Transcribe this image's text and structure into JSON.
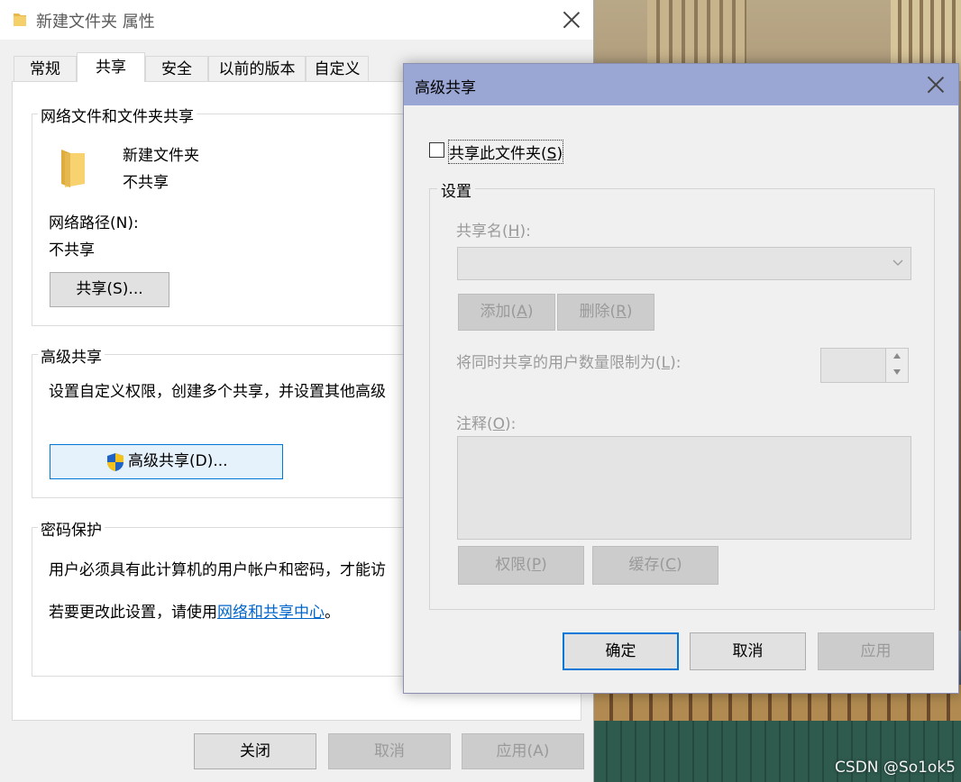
{
  "properties_window": {
    "title": "新建文件夹 属性",
    "tabs": [
      {
        "label": "常规"
      },
      {
        "label": "共享"
      },
      {
        "label": "安全"
      },
      {
        "label": "以前的版本"
      },
      {
        "label": "自定义"
      }
    ],
    "network_sharing": {
      "legend": "网络文件和文件夹共享",
      "folder_name": "新建文件夹",
      "folder_status": "不共享",
      "path_label": "网络路径(N):",
      "path_value": "不共享",
      "share_button": "共享(S)..."
    },
    "advanced_sharing": {
      "legend": "高级共享",
      "description": "设置自定义权限，创建多个共享，并设置其他高级",
      "button": "高级共享(D)..."
    },
    "password_protection": {
      "legend": "密码保护",
      "line1": "用户必须具有此计算机的用户帐户和密码，才能访",
      "line2_prefix": "若要更改此设置，请使用",
      "line2_link": "网络和共享中心",
      "line2_suffix": "。"
    },
    "footer": {
      "close": "关闭",
      "cancel": "取消",
      "apply": "应用(A)"
    }
  },
  "advanced_dialog": {
    "title": "高级共享",
    "share_checkbox": {
      "label_prefix": "共享此文件夹(",
      "accel": "S",
      "label_suffix": ")",
      "checked": false
    },
    "settings_legend": "设置",
    "share_name_label": {
      "prefix": "共享名(",
      "accel": "H",
      "suffix": "):"
    },
    "share_name_value": "",
    "add_button": {
      "prefix": "添加(",
      "accel": "A",
      "suffix": ")"
    },
    "remove_button": {
      "prefix": "删除(",
      "accel": "R",
      "suffix": ")"
    },
    "limit_label": {
      "prefix": "将同时共享的用户数量限制为(",
      "accel": "L",
      "suffix": "):"
    },
    "limit_value": "",
    "comment_label": {
      "prefix": "注释(",
      "accel": "O",
      "suffix": "):"
    },
    "comment_value": "",
    "permissions_button": {
      "prefix": "权限(",
      "accel": "P",
      "suffix": ")"
    },
    "caching_button": {
      "prefix": "缓存(",
      "accel": "C",
      "suffix": ")"
    },
    "ok": "确定",
    "cancel": "取消",
    "apply": "应用"
  },
  "watermark": "CSDN @So1ok5"
}
